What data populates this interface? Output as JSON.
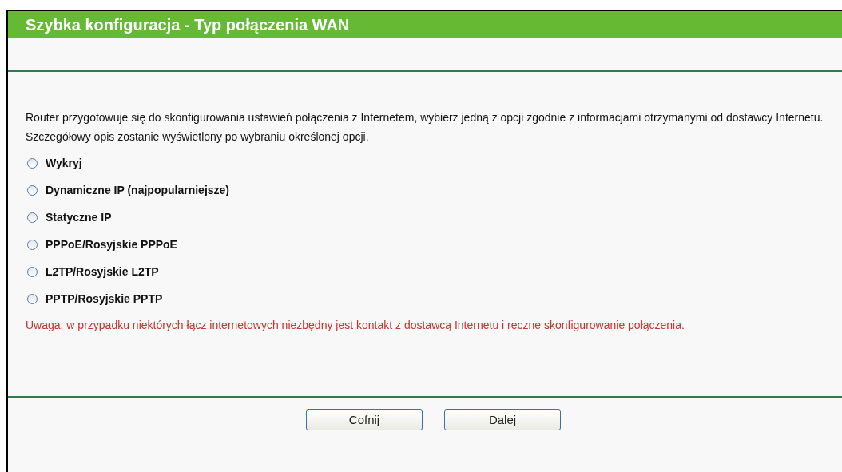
{
  "header": {
    "title": "Szybka konfiguracja - Typ połączenia WAN"
  },
  "intro": [
    "Router przygotowuje się do skonfigurowania ustawień połączenia z Internetem, wybierz jedną z opcji zgodnie z informacjami otrzymanymi od dostawcy Internetu.",
    "Szczegółowy opis zostanie wyświetlony po wybraniu określonej opcji."
  ],
  "options": [
    {
      "label": "Wykryj",
      "selected": false
    },
    {
      "label": "Dynamiczne IP (najpopularniejsze)",
      "selected": false
    },
    {
      "label": "Statyczne IP",
      "selected": false
    },
    {
      "label": "PPPoE/Rosyjskie PPPoE",
      "selected": false
    },
    {
      "label": "L2TP/Rosyjskie L2TP",
      "selected": false
    },
    {
      "label": "PPTP/Rosyjskie PPTP",
      "selected": false
    }
  ],
  "note": "Uwaga: w przypadku niektórych łącz internetowych niezbędny jest kontakt z dostawcą Internetu i ręczne skonfigurowanie połączenia.",
  "buttons": [
    "Cofnij",
    "Dalej"
  ]
}
